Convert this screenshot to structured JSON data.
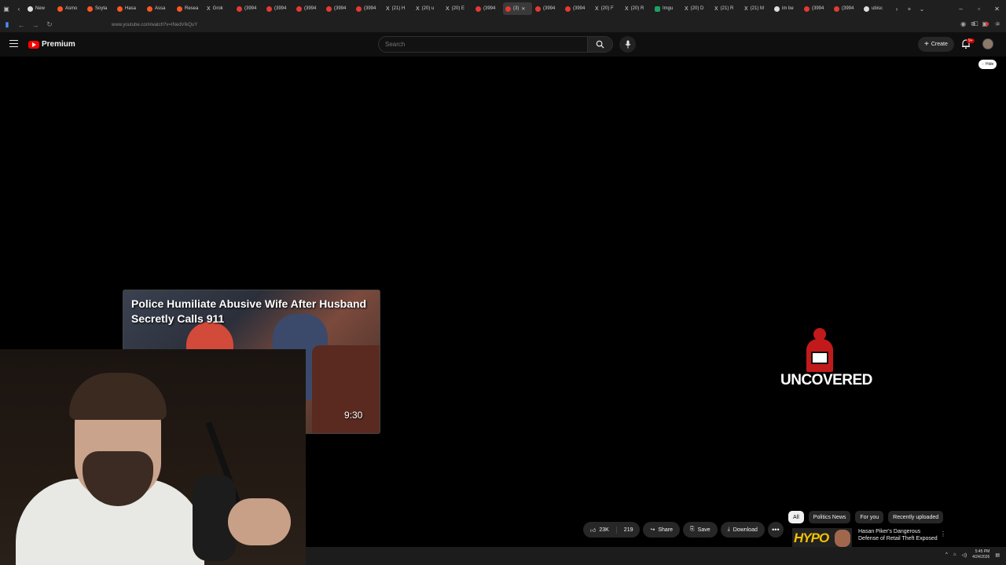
{
  "browser": {
    "tabs": [
      {
        "label": "New",
        "fav": "w"
      },
      {
        "label": "Asmo",
        "fav": "o"
      },
      {
        "label": "Soyta",
        "fav": "o"
      },
      {
        "label": "Hasa",
        "fav": "o"
      },
      {
        "label": "Assa",
        "fav": "o"
      },
      {
        "label": "Resea",
        "fav": "o"
      },
      {
        "label": "Grok",
        "fav": "x"
      },
      {
        "label": "(3994",
        "fav": "r"
      },
      {
        "label": "(3994",
        "fav": "r"
      },
      {
        "label": "(3994",
        "fav": "r"
      },
      {
        "label": "(3994",
        "fav": "r"
      },
      {
        "label": "(3994",
        "fav": "r"
      },
      {
        "label": "(21) H",
        "fav": "x"
      },
      {
        "label": "(20) u",
        "fav": "x"
      },
      {
        "label": "(20) E",
        "fav": "x"
      },
      {
        "label": "(3994",
        "fav": "r"
      },
      {
        "label": "(3)",
        "fav": "r",
        "active": true
      },
      {
        "label": "(3994",
        "fav": "r"
      },
      {
        "label": "(3994",
        "fav": "r"
      },
      {
        "label": "(20) F",
        "fav": "x"
      },
      {
        "label": "(20) R",
        "fav": "x"
      },
      {
        "label": "Imgu",
        "fav": "g"
      },
      {
        "label": "(20) D",
        "fav": "x"
      },
      {
        "label": "(21) R",
        "fav": "x"
      },
      {
        "label": "(21) M",
        "fav": "x"
      },
      {
        "label": "im be",
        "fav": "w"
      },
      {
        "label": "(3994",
        "fav": "r"
      },
      {
        "label": "(3994",
        "fav": "r"
      },
      {
        "label": "ubisc",
        "fav": "w"
      }
    ],
    "url": "www.youtube.com/watch?v=INedVIkQuY"
  },
  "youtube": {
    "logo_text": "Premium",
    "search_placeholder": "Search",
    "create_label": "Create",
    "notif_badge": "9+",
    "hide_label": "Hide"
  },
  "video": {
    "thumb_title": "Police Humiliate Abusive Wife After Husband Secretly Calls 911",
    "duration": "9:30",
    "uncovered_text": "UNCOVERED"
  },
  "actions": {
    "likes": "23K",
    "dislikes": "219",
    "share": "Share",
    "save": "Save",
    "download": "Download",
    "more": "•••"
  },
  "chips": [
    "All",
    "Politics News",
    "For you",
    "Recently uploaded"
  ],
  "recommended": {
    "thumb_text": "HYPO",
    "title": "Hasan Piker's Dangerous Defense of Retail Theft Exposed"
  },
  "taskbar": {
    "time": "5:45 PM",
    "date": "4/24/2026"
  },
  "colors": {
    "yt_red": "#ff0000",
    "background": "#000000",
    "chip_active": "#f1f1f1"
  }
}
